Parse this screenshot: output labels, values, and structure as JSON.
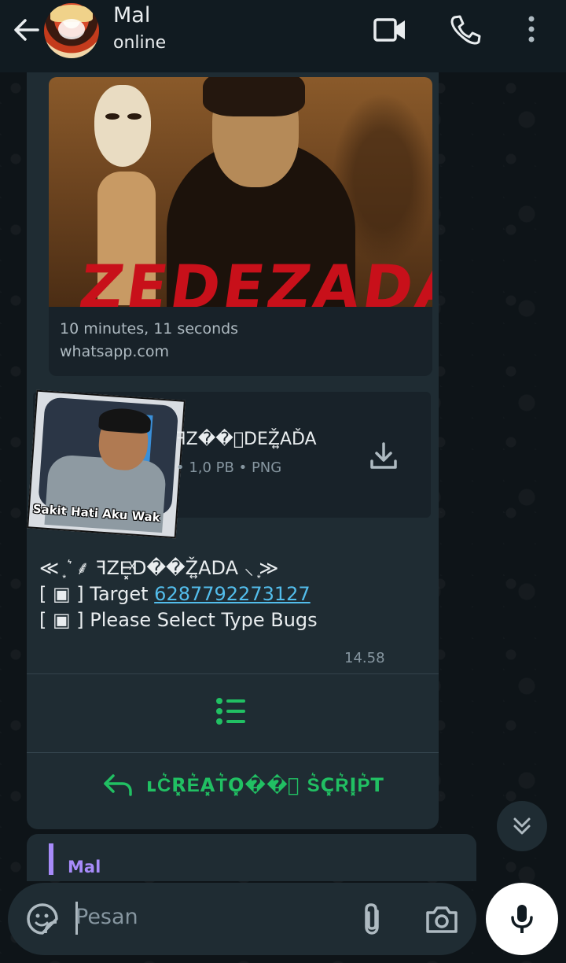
{
  "header": {
    "contact_name": "Mal",
    "status": "online"
  },
  "message": {
    "link_preview": {
      "poster_title": "ZEDEZADA",
      "title": "10 minutes, 11 seconds",
      "domain": "whatsapp.com"
    },
    "document": {
      "thumbnail_caption": "Sakit Hati Aku Wak",
      "file_name": "ꟻZ��ͯDEŽ͍AĎA",
      "info": "• 1,0 PB • PNG"
    },
    "text": {
      "line1": "≪ ͙ ͛ ⸙ ꟻZE͓ͯD��Ž͍ADA ⸜ ͙≫",
      "line2_prefix": "[ ▣ ] Target ",
      "line2_link": "6287792273127",
      "line3": "[ ▣ ] Please Select Type Bugs"
    },
    "time": "14.58",
    "reply_button_label": "ʟC͛R͓E͛A͓T͛O͓��ͫ S͛C͓R͛I͓P͛T"
  },
  "next_message": {
    "sender": "Mal"
  },
  "input": {
    "placeholder": "Pesan"
  },
  "colors": {
    "accent_green": "#21c063",
    "link_blue": "#53bdeb",
    "bubble": "#1f2c33",
    "header": "#111b21"
  }
}
